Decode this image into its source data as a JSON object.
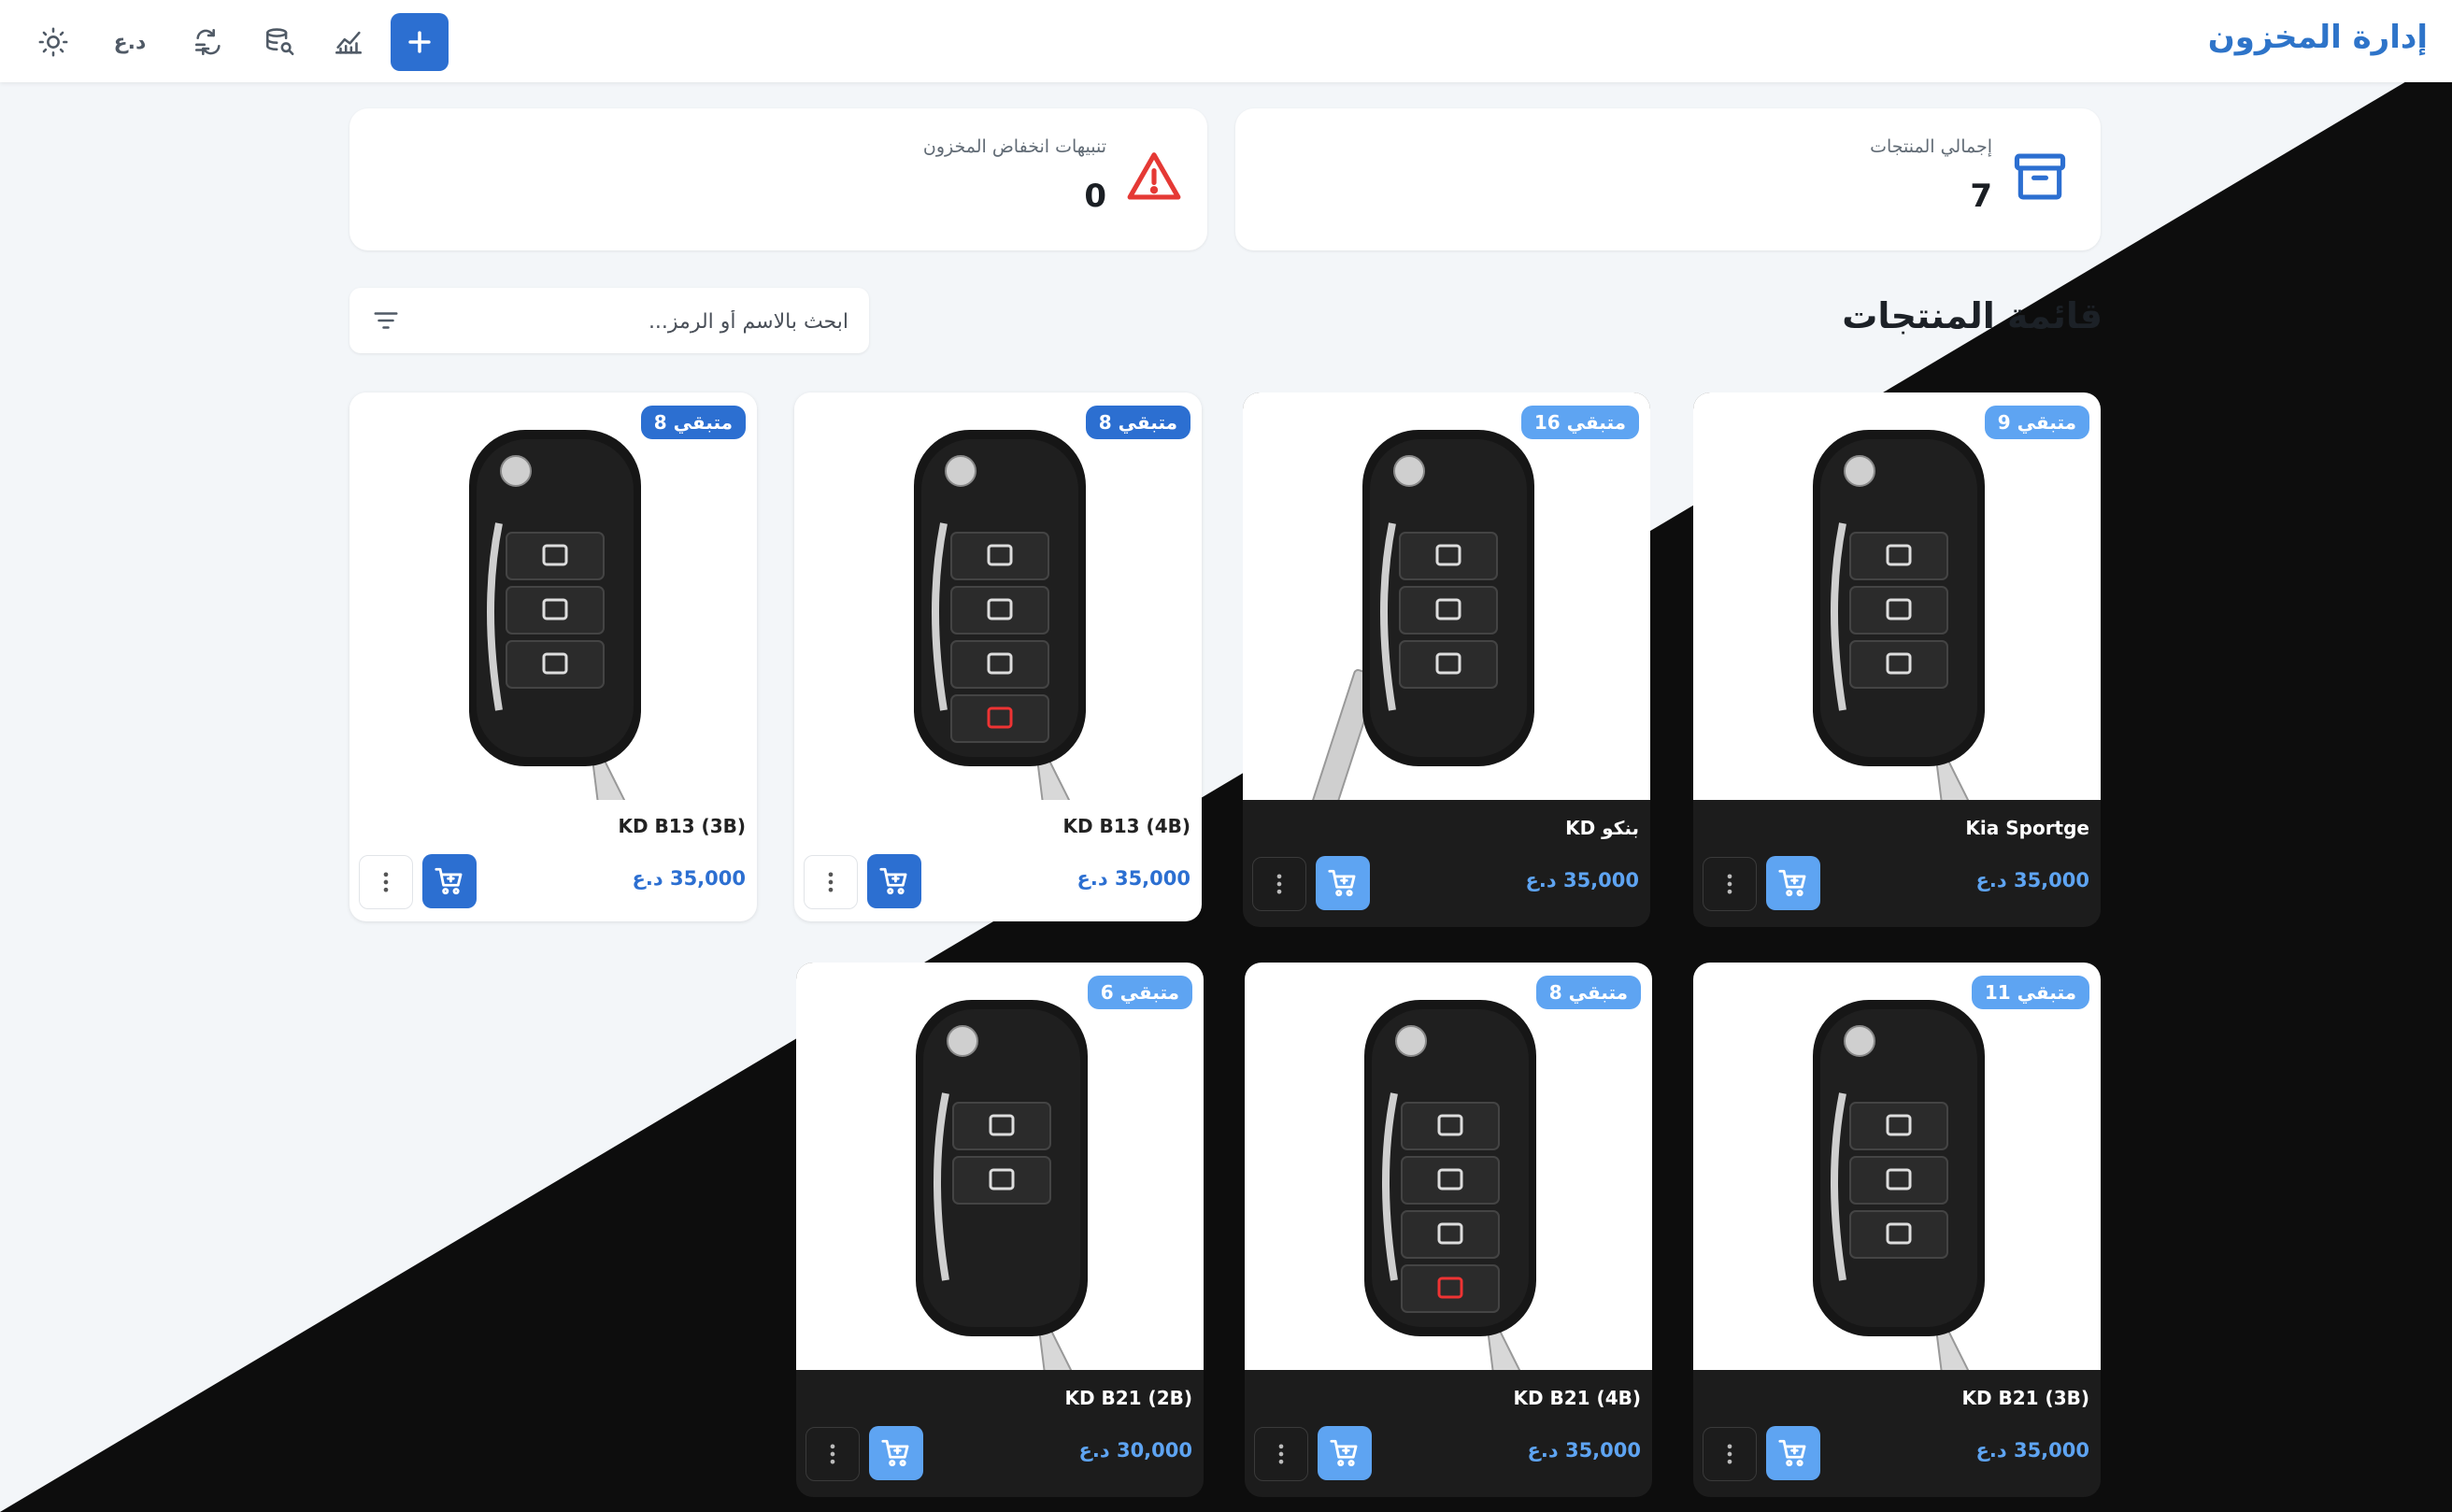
{
  "app": {
    "title": "إدارة المخزون"
  },
  "toolbar": {
    "add_icon": "plus-icon",
    "analytics_icon": "chart-line-icon",
    "inventory_search_icon": "database-search-icon",
    "exchange_icon": "exchange-icon",
    "currency_label": "د.ع",
    "theme_icon": "sun-icon"
  },
  "stats": {
    "total_products": {
      "label": "إجمالي المنتجات",
      "value": "7",
      "icon": "archive-box-icon"
    },
    "low_stock": {
      "label": "تنبيهات انخفاض المخزون",
      "value": "0",
      "icon": "warning-icon"
    }
  },
  "section": {
    "title": "قائمة المنتجات"
  },
  "search": {
    "placeholder": "ابحث بالاسم أو الرمز...",
    "value": ""
  },
  "products": [
    {
      "name": "Kia Sportge",
      "badge": "متبقي 9",
      "price": "35,000 د.ع",
      "remaining": 9
    },
    {
      "name": "KD بنكو",
      "badge": "متبقي 16",
      "price": "35,000 د.ع",
      "remaining": 16
    },
    {
      "name": "KD B13 (4B)",
      "badge": "متبقي 8",
      "price": "35,000 د.ع",
      "remaining": 8
    },
    {
      "name": "KD B13 (3B)",
      "badge": "متبقي 8",
      "price": "35,000 د.ع",
      "remaining": 8
    },
    {
      "name": "KD B21 (3B)",
      "badge": "متبقي 11",
      "price": "35,000 د.ع",
      "remaining": 11
    },
    {
      "name": "KD B21 (4B)",
      "badge": "متبقي 8",
      "price": "35,000 د.ع",
      "remaining": 8
    },
    {
      "name": "KD B21 (2B)",
      "badge": "متبقي 6",
      "price": "30,000 د.ع",
      "remaining": 6
    }
  ],
  "colors": {
    "primary": "#2c6fd1",
    "primary_light": "#5ea4f2",
    "warning": "#e53935",
    "dark_bg": "#0d0d0d"
  }
}
